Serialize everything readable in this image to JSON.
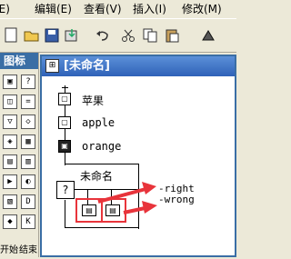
{
  "menubar": {
    "items": [
      {
        "label": "(E)"
      },
      {
        "label": "编辑(E)"
      },
      {
        "label": "查看(V)"
      },
      {
        "label": "插入(I)"
      },
      {
        "label": "修改(M)"
      }
    ]
  },
  "toolbar": {
    "buttons": [
      "new-icon",
      "open-icon",
      "save-icon",
      "import-icon",
      "undo-icon",
      "cut-icon",
      "copy-icon",
      "paste-icon",
      "run-icon"
    ]
  },
  "palette": {
    "title": "图标",
    "footer_start": "开始",
    "footer_end": "结束"
  },
  "window": {
    "title": "[未命名]",
    "icon_glyph": "⊞"
  },
  "flow": {
    "nodes": [
      {
        "label": "苹果"
      },
      {
        "label": "apple"
      },
      {
        "label": "orange"
      },
      {
        "label": "未命名"
      }
    ],
    "branch_right": "right",
    "branch_wrong": "wrong",
    "decision_glyph": "?"
  },
  "annotations": {
    "arrow_color": "#e8343b",
    "box_color": "#e8343b"
  }
}
